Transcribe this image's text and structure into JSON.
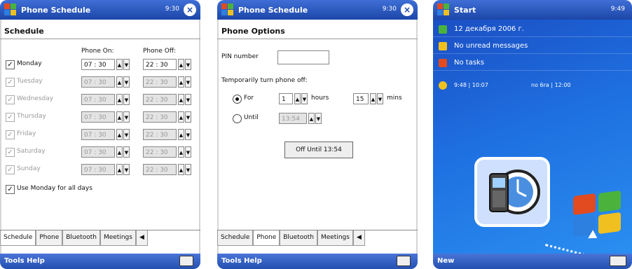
{
  "left": {
    "title": "Phone Schedule",
    "status": "9:30",
    "heading": "Schedule",
    "col_on": "Phone On:",
    "col_off": "Phone Off:",
    "days": [
      {
        "name": "Monday",
        "on": "07 : 30",
        "off": "22 : 30"
      },
      {
        "name": "Tuesday",
        "on": "07 : 30",
        "off": "22 : 30"
      },
      {
        "name": "Wednesday",
        "on": "07 : 30",
        "off": "22 : 30"
      },
      {
        "name": "Thursday",
        "on": "07 : 30",
        "off": "22 : 30"
      },
      {
        "name": "Friday",
        "on": "07 : 30",
        "off": "22 : 30"
      },
      {
        "name": "Saturday",
        "on": "07 : 30",
        "off": "22 : 30"
      },
      {
        "name": "Sunday",
        "on": "07 : 30",
        "off": "22 : 30"
      }
    ],
    "use_monday": "Use Monday for all days",
    "tabs": [
      "Schedule",
      "Phone",
      "Bluetooth",
      "Meetings"
    ],
    "menu": "Tools Help"
  },
  "middle": {
    "title": "Phone Schedule",
    "status": "9:30",
    "heading": "Phone Options",
    "pin_label": "PIN number",
    "pin_value": "",
    "temp_label": "Temporarily turn phone off:",
    "for_label": "For",
    "hours_value": "1",
    "hours_label": "hours",
    "mins_value": "15",
    "mins_label": "mins",
    "until_label": "Until",
    "until_value": "13:54",
    "off_button": "Off Until 13:54",
    "tabs": [
      "Schedule",
      "Phone",
      "Bluetooth",
      "Meetings"
    ],
    "menu": "Tools Help"
  },
  "right": {
    "title": "Start",
    "status": "9:49",
    "date": "12 декабря 2006 г.",
    "messages": "No unread messages",
    "tasks": "No tasks",
    "time_a": "9:48 | 10:07",
    "time_b": "no 6ra | 12:00",
    "menu": "New"
  }
}
